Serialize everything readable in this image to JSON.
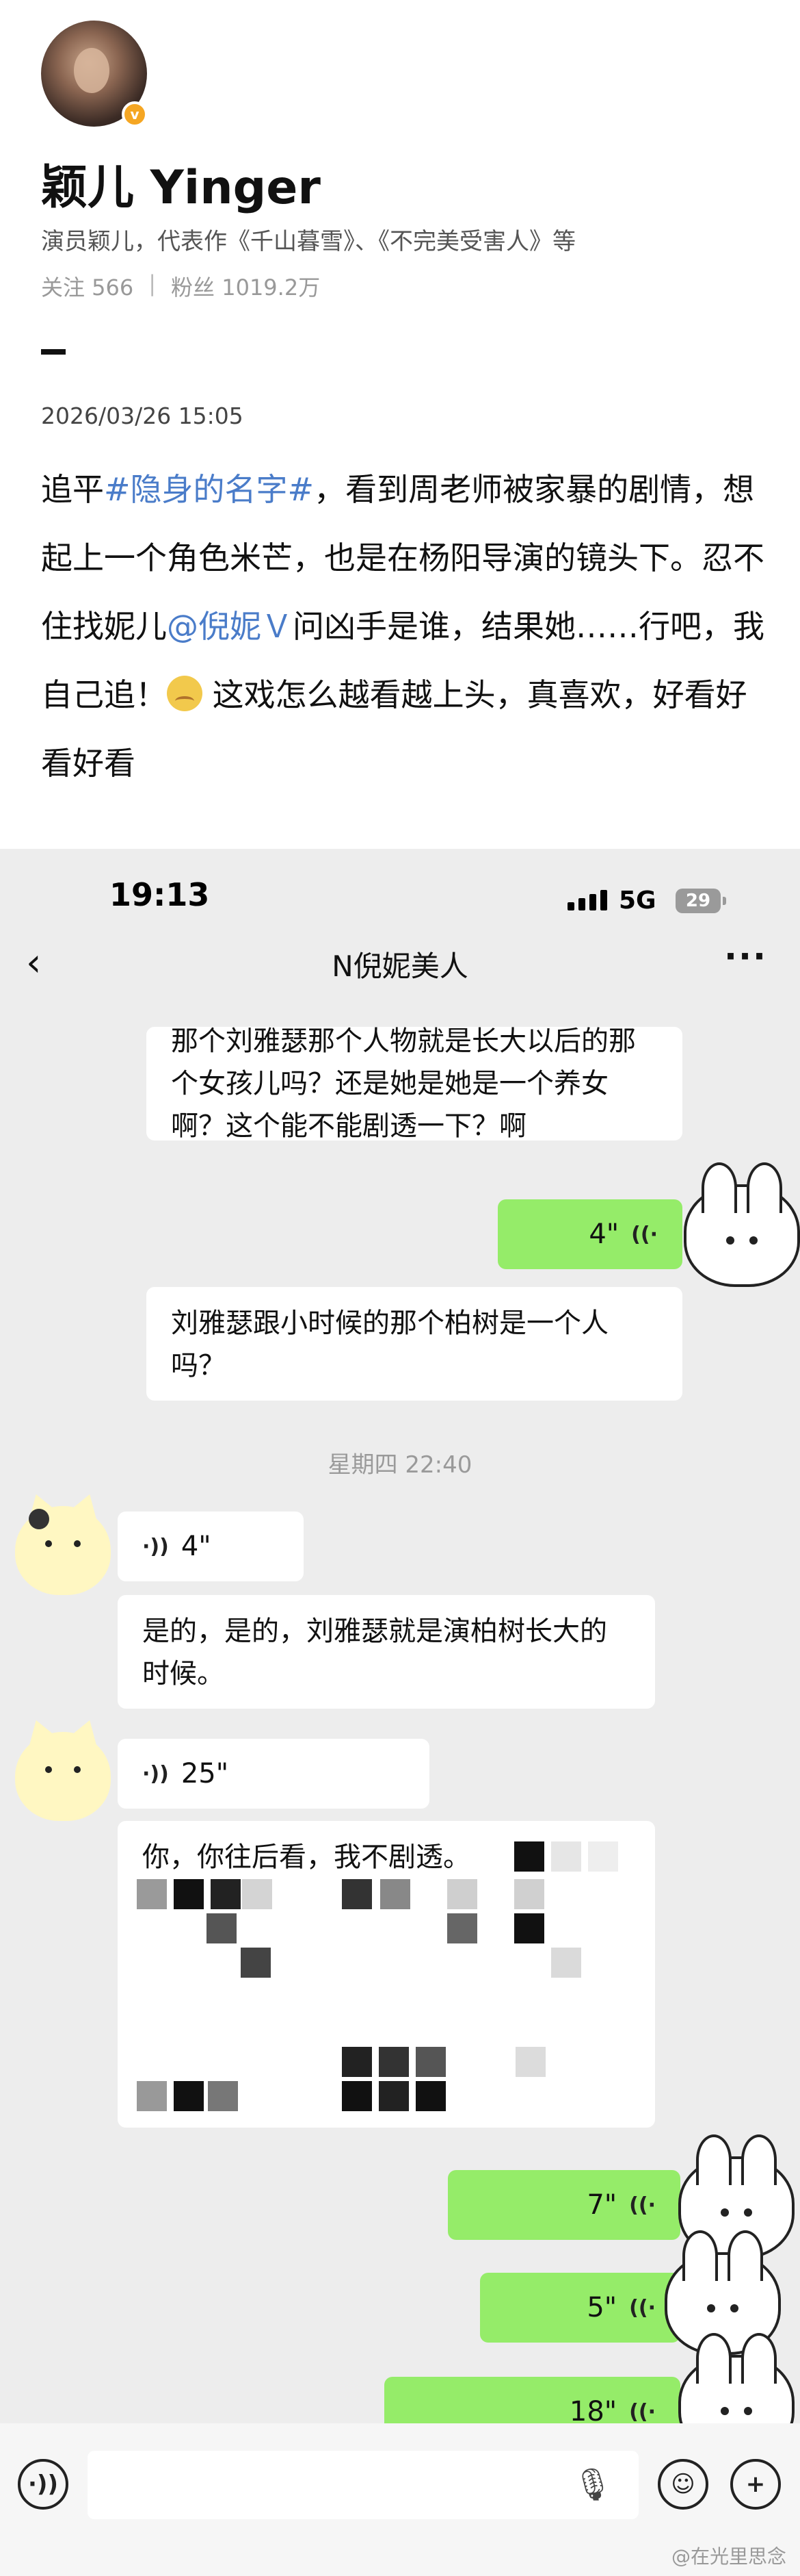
{
  "profile": {
    "name": "颖儿 Yinger",
    "bio": "演员颖儿，代表作《千山暮雪》、《不完美受害人》等",
    "following_label": "关注 566",
    "followers_label": "粉丝 1019.2万",
    "separator": "|",
    "verified_badge": "v"
  },
  "post": {
    "time": "2026/03/26 15:05",
    "text_1": "追平",
    "hashtag": "#隐身的名字#",
    "text_2": "，看到周老师被家暴的剧情，想起上一个角色米芒，也是在杨阳导演的镜头下。忍不住找妮儿",
    "mention": "@倪妮Ｖ",
    "text_3": "问凶手是谁，结果她……行吧，我自己追！",
    "text_4": "这戏怎么越看越上头，真喜欢，好看好看好看",
    "link_color": "#4a7cc9"
  },
  "phone": {
    "clock": "19:13",
    "network": "5G",
    "battery": "29",
    "back_icon": "‹",
    "chat_title": "N倪妮美人",
    "more_icon": "···"
  },
  "messages": {
    "m1": "那个刘雅瑟那个人物就是长大以后的那个女孩儿吗？还是她是她是一个养女啊？这个能不能剧透一下？啊",
    "v1": "4\"",
    "m2": "刘雅瑟跟小时候的那个柏树是一个人吗？",
    "timestamp": "星期四 22:40",
    "v2": "4\"",
    "m3": "是的，是的，刘雅瑟就是演柏树长大的时候。",
    "v3": "25\"",
    "m4": "你，你往后看，我不剧透。",
    "v4": "7\"",
    "v5": "5\"",
    "v6": "18\""
  },
  "colors": {
    "green_bubble": "#95ec69",
    "chat_bg": "#ededed"
  },
  "footer": {
    "watermark": "@在光里思念"
  }
}
